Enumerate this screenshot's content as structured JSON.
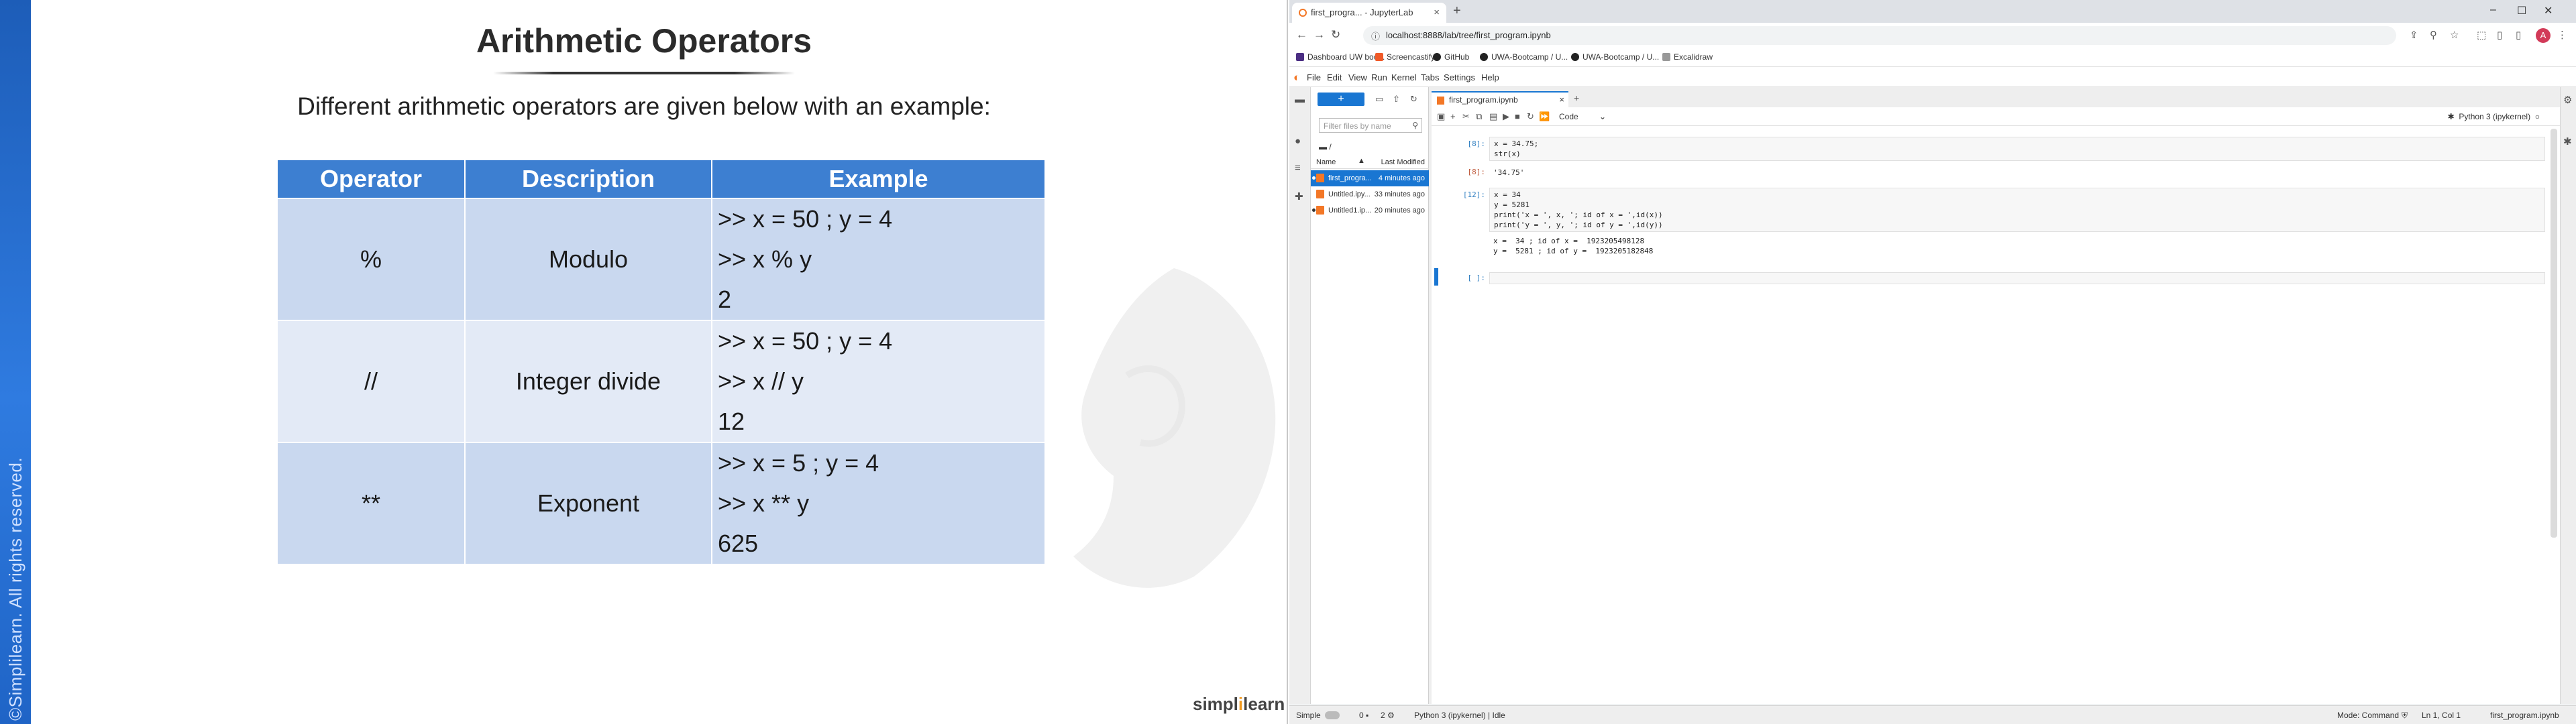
{
  "slide": {
    "title": "Arithmetic Operators",
    "subtitle": "Different arithmetic operators are given below with an example:",
    "copyright": "©Simplilearn. All rights reserved.",
    "logo_main": "simpl",
    "logo_accent": "i",
    "logo_tail": "learn",
    "table": {
      "headers": [
        "Operator",
        "Description",
        "Example"
      ],
      "rows": [
        {
          "operator": "%",
          "description": "Modulo",
          "example": [
            ">> x = 50 ; y = 4",
            ">> x  %  y",
            "2"
          ]
        },
        {
          "operator": "//",
          "description": "Integer divide",
          "example": [
            ">> x = 50 ; y = 4",
            ">> x  //  y",
            "12"
          ]
        },
        {
          "operator": "**",
          "description": "Exponent",
          "example": [
            ">> x = 5 ; y = 4",
            ">> x ** y",
            "625"
          ]
        }
      ]
    }
  },
  "browser": {
    "tab_title": "first_progra... - JupyterLab",
    "url": "localhost:8888/lab/tree/first_program.ipynb",
    "avatar_letter": "A",
    "bookmarks": [
      "Dashboard UW boo...",
      "Screencastify",
      "GitHub",
      "UWA-Bootcamp / U...",
      "UWA-Bootcamp / U...",
      "Excalidraw"
    ],
    "accent_color": "#1976d2"
  },
  "jupyter": {
    "menus": [
      "File",
      "Edit",
      "View",
      "Run",
      "Kernel",
      "Tabs",
      "Settings",
      "Help"
    ],
    "filter_placeholder": "Filter files by name",
    "breadcrumb": "/",
    "col_name": "Name",
    "col_modified": "Last Modified",
    "files": [
      {
        "name": "first_progra...",
        "modified": "4 minutes ago",
        "selected": true
      },
      {
        "name": "Untitled.ipy...",
        "modified": "33 minutes ago",
        "selected": false
      },
      {
        "name": "Untitled1.ip...",
        "modified": "20 minutes ago",
        "selected": false
      }
    ],
    "notebook_tab": "first_program.ipynb",
    "cell_type": "Code",
    "kernel": "Python 3 (ipykernel)",
    "cells": [
      {
        "prompt": "[8]:",
        "input": [
          "x = 34.75;",
          "str(x)"
        ]
      },
      {
        "prompt": "[8]:",
        "output": [
          "'34.75'"
        ]
      },
      {
        "prompt": "[12]:",
        "input": [
          "x = 34",
          "y = 5281",
          "print('x = ', x, '; id of x = ',id(x))",
          "print('y = ', y, '; id of y = ',id(y))"
        ]
      },
      {
        "output": [
          "x =  34 ; id of x =  1923205498128",
          "y =  5281 ; id of y =  1923205182848"
        ]
      },
      {
        "prompt": "[ ]:",
        "input": [
          ""
        ]
      }
    ],
    "status": {
      "mode_label": "Simple",
      "count_a": "0",
      "count_b": "2",
      "kernel_status": "Python 3 (ipykernel) | Idle",
      "command_mode": "Mode: Command",
      "cursor": "Ln 1, Col 1",
      "file": "first_program.ipynb"
    }
  }
}
